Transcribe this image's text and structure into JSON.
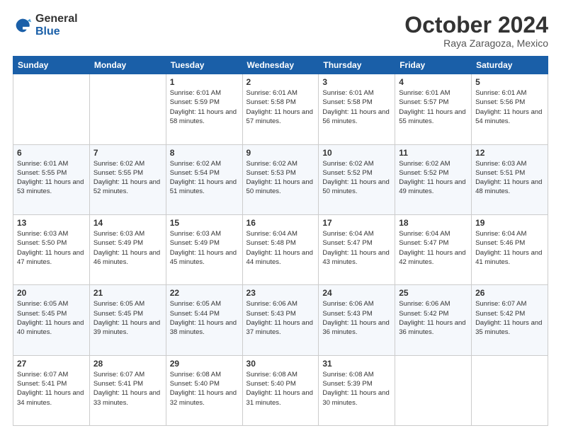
{
  "logo": {
    "general": "General",
    "blue": "Blue"
  },
  "title": "October 2024",
  "subtitle": "Raya Zaragoza, Mexico",
  "weekdays": [
    "Sunday",
    "Monday",
    "Tuesday",
    "Wednesday",
    "Thursday",
    "Friday",
    "Saturday"
  ],
  "weeks": [
    [
      {
        "day": "",
        "info": ""
      },
      {
        "day": "",
        "info": ""
      },
      {
        "day": "1",
        "info": "Sunrise: 6:01 AM\nSunset: 5:59 PM\nDaylight: 11 hours and 58 minutes."
      },
      {
        "day": "2",
        "info": "Sunrise: 6:01 AM\nSunset: 5:58 PM\nDaylight: 11 hours and 57 minutes."
      },
      {
        "day": "3",
        "info": "Sunrise: 6:01 AM\nSunset: 5:58 PM\nDaylight: 11 hours and 56 minutes."
      },
      {
        "day": "4",
        "info": "Sunrise: 6:01 AM\nSunset: 5:57 PM\nDaylight: 11 hours and 55 minutes."
      },
      {
        "day": "5",
        "info": "Sunrise: 6:01 AM\nSunset: 5:56 PM\nDaylight: 11 hours and 54 minutes."
      }
    ],
    [
      {
        "day": "6",
        "info": "Sunrise: 6:01 AM\nSunset: 5:55 PM\nDaylight: 11 hours and 53 minutes."
      },
      {
        "day": "7",
        "info": "Sunrise: 6:02 AM\nSunset: 5:55 PM\nDaylight: 11 hours and 52 minutes."
      },
      {
        "day": "8",
        "info": "Sunrise: 6:02 AM\nSunset: 5:54 PM\nDaylight: 11 hours and 51 minutes."
      },
      {
        "day": "9",
        "info": "Sunrise: 6:02 AM\nSunset: 5:53 PM\nDaylight: 11 hours and 50 minutes."
      },
      {
        "day": "10",
        "info": "Sunrise: 6:02 AM\nSunset: 5:52 PM\nDaylight: 11 hours and 50 minutes."
      },
      {
        "day": "11",
        "info": "Sunrise: 6:02 AM\nSunset: 5:52 PM\nDaylight: 11 hours and 49 minutes."
      },
      {
        "day": "12",
        "info": "Sunrise: 6:03 AM\nSunset: 5:51 PM\nDaylight: 11 hours and 48 minutes."
      }
    ],
    [
      {
        "day": "13",
        "info": "Sunrise: 6:03 AM\nSunset: 5:50 PM\nDaylight: 11 hours and 47 minutes."
      },
      {
        "day": "14",
        "info": "Sunrise: 6:03 AM\nSunset: 5:49 PM\nDaylight: 11 hours and 46 minutes."
      },
      {
        "day": "15",
        "info": "Sunrise: 6:03 AM\nSunset: 5:49 PM\nDaylight: 11 hours and 45 minutes."
      },
      {
        "day": "16",
        "info": "Sunrise: 6:04 AM\nSunset: 5:48 PM\nDaylight: 11 hours and 44 minutes."
      },
      {
        "day": "17",
        "info": "Sunrise: 6:04 AM\nSunset: 5:47 PM\nDaylight: 11 hours and 43 minutes."
      },
      {
        "day": "18",
        "info": "Sunrise: 6:04 AM\nSunset: 5:47 PM\nDaylight: 11 hours and 42 minutes."
      },
      {
        "day": "19",
        "info": "Sunrise: 6:04 AM\nSunset: 5:46 PM\nDaylight: 11 hours and 41 minutes."
      }
    ],
    [
      {
        "day": "20",
        "info": "Sunrise: 6:05 AM\nSunset: 5:45 PM\nDaylight: 11 hours and 40 minutes."
      },
      {
        "day": "21",
        "info": "Sunrise: 6:05 AM\nSunset: 5:45 PM\nDaylight: 11 hours and 39 minutes."
      },
      {
        "day": "22",
        "info": "Sunrise: 6:05 AM\nSunset: 5:44 PM\nDaylight: 11 hours and 38 minutes."
      },
      {
        "day": "23",
        "info": "Sunrise: 6:06 AM\nSunset: 5:43 PM\nDaylight: 11 hours and 37 minutes."
      },
      {
        "day": "24",
        "info": "Sunrise: 6:06 AM\nSunset: 5:43 PM\nDaylight: 11 hours and 36 minutes."
      },
      {
        "day": "25",
        "info": "Sunrise: 6:06 AM\nSunset: 5:42 PM\nDaylight: 11 hours and 36 minutes."
      },
      {
        "day": "26",
        "info": "Sunrise: 6:07 AM\nSunset: 5:42 PM\nDaylight: 11 hours and 35 minutes."
      }
    ],
    [
      {
        "day": "27",
        "info": "Sunrise: 6:07 AM\nSunset: 5:41 PM\nDaylight: 11 hours and 34 minutes."
      },
      {
        "day": "28",
        "info": "Sunrise: 6:07 AM\nSunset: 5:41 PM\nDaylight: 11 hours and 33 minutes."
      },
      {
        "day": "29",
        "info": "Sunrise: 6:08 AM\nSunset: 5:40 PM\nDaylight: 11 hours and 32 minutes."
      },
      {
        "day": "30",
        "info": "Sunrise: 6:08 AM\nSunset: 5:40 PM\nDaylight: 11 hours and 31 minutes."
      },
      {
        "day": "31",
        "info": "Sunrise: 6:08 AM\nSunset: 5:39 PM\nDaylight: 11 hours and 30 minutes."
      },
      {
        "day": "",
        "info": ""
      },
      {
        "day": "",
        "info": ""
      }
    ]
  ]
}
